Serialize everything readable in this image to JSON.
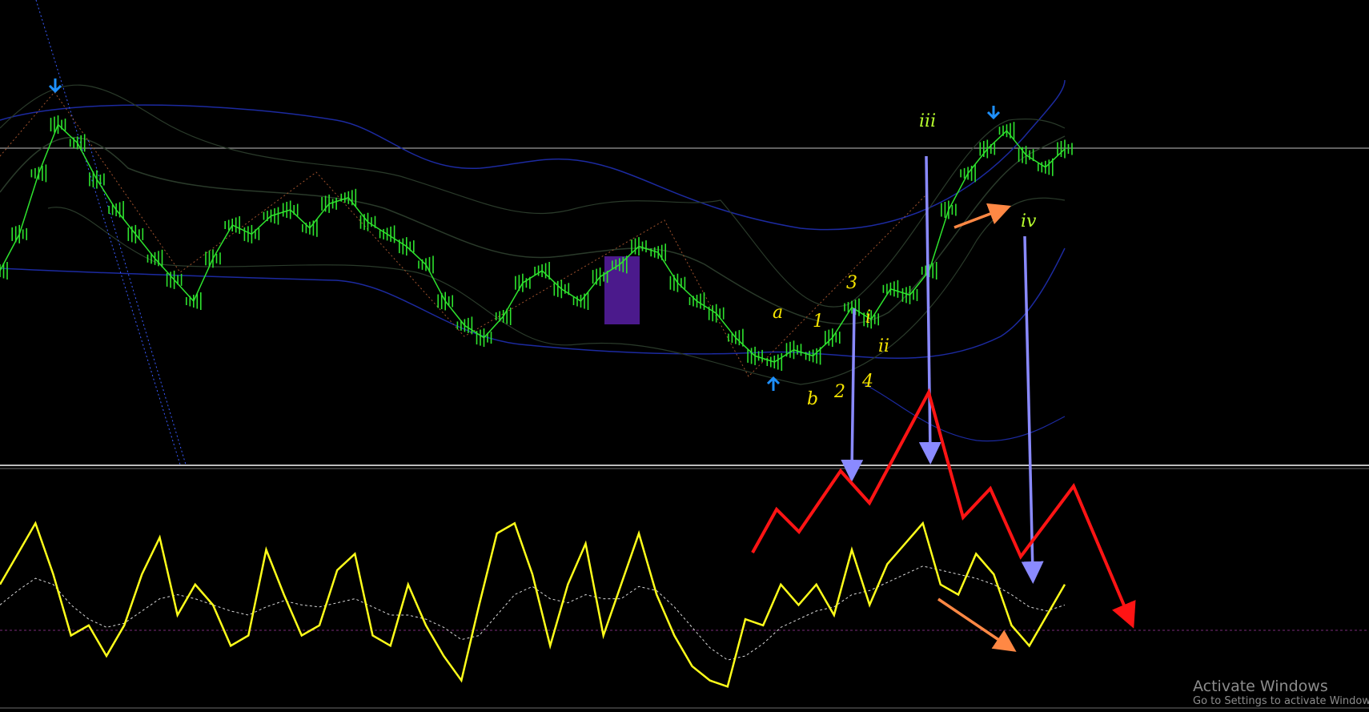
{
  "colors": {
    "background": "#000000",
    "price_candles": "#2ee32e",
    "bollinger_outer": "#1c2aa0",
    "bollinger_inner": "#2a3a2a",
    "oscillator": "#ffff1a",
    "signal": "#d9d9d9",
    "red_path": "#ff1414",
    "blue_arrows": "#8a8aff",
    "orange_arrows": "#ff8844",
    "label_yellow": "#f5e400",
    "label_green": "#b8ff2e",
    "highlight_box": "#4b1a8c",
    "arrow_marker": "#1e90ff"
  },
  "wave_labels": {
    "a": "a",
    "b": "b",
    "one": "1",
    "two": "2",
    "three": "3",
    "four": "4",
    "i": "i",
    "ii": "ii",
    "iii": "iii",
    "iv": "iv"
  },
  "watermark": {
    "title": "Activate Windows",
    "subtitle": "Go to Settings to activate Windows."
  },
  "chart_data": [
    {
      "type": "line",
      "panel": "price",
      "series": [
        {
          "values": [
            0.4,
            0.52,
            0.72,
            0.88,
            0.82,
            0.7,
            0.6,
            0.52,
            0.44,
            0.37,
            0.3,
            0.44,
            0.55,
            0.52,
            0.58,
            0.6,
            0.54,
            0.62,
            0.64,
            0.56,
            0.52,
            0.48,
            0.42,
            0.3,
            0.22,
            0.18,
            0.25,
            0.36,
            0.4,
            0.34,
            0.3,
            0.38,
            0.42,
            0.48,
            0.46,
            0.36,
            0.3,
            0.26,
            0.18,
            0.12,
            0.1,
            0.14,
            0.12,
            0.18,
            0.28,
            0.24,
            0.34,
            0.32,
            0.4,
            0.6,
            0.72,
            0.8,
            0.86,
            0.78,
            0.74,
            0.8
          ]
        }
      ]
    },
    {
      "type": "line",
      "panel": "oscillator",
      "series": [
        {
          "values": [
            0.55,
            0.7,
            0.85,
            0.6,
            0.3,
            0.35,
            0.2,
            0.35,
            0.6,
            0.78,
            0.4,
            0.55,
            0.45,
            0.25,
            0.3,
            0.72,
            0.5,
            0.3,
            0.35,
            0.62,
            0.7,
            0.3,
            0.25,
            0.55,
            0.35,
            0.2,
            0.08,
            0.45,
            0.8,
            0.85,
            0.6,
            0.25,
            0.55,
            0.75,
            0.3,
            0.55,
            0.8,
            0.5,
            0.3,
            0.15,
            0.08,
            0.05,
            0.38,
            0.35,
            0.55,
            0.45,
            0.55,
            0.4,
            0.72,
            0.45,
            0.65,
            0.75,
            0.85,
            0.55,
            0.5,
            0.7,
            0.6,
            0.35,
            0.25,
            0.4,
            0.55
          ]
        },
        {
          "values": [
            0.45,
            0.52,
            0.58,
            0.55,
            0.45,
            0.38,
            0.34,
            0.36,
            0.42,
            0.48,
            0.5,
            0.48,
            0.45,
            0.42,
            0.4,
            0.44,
            0.47,
            0.45,
            0.44,
            0.46,
            0.48,
            0.44,
            0.4,
            0.4,
            0.38,
            0.34,
            0.28,
            0.3,
            0.4,
            0.5,
            0.54,
            0.48,
            0.46,
            0.5,
            0.48,
            0.48,
            0.54,
            0.52,
            0.44,
            0.34,
            0.24,
            0.18,
            0.2,
            0.26,
            0.34,
            0.38,
            0.42,
            0.44,
            0.5,
            0.52,
            0.56,
            0.6,
            0.64,
            0.62,
            0.6,
            0.58,
            0.55,
            0.5,
            0.44,
            0.42,
            0.45
          ]
        }
      ]
    }
  ]
}
